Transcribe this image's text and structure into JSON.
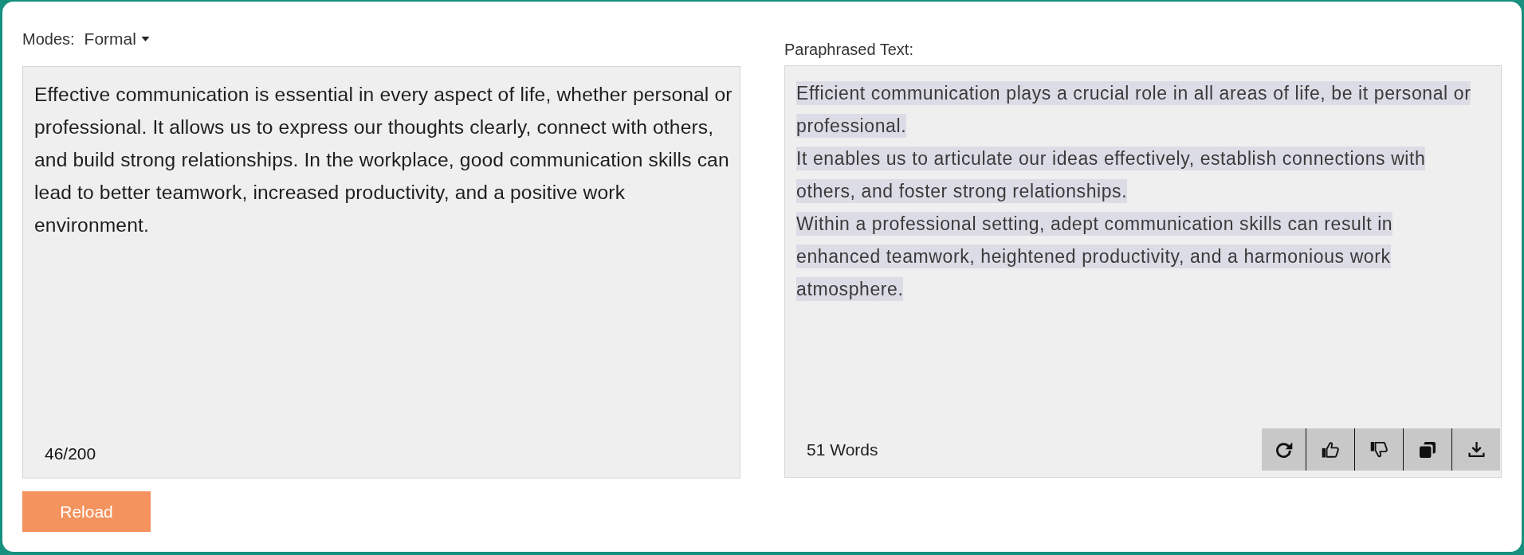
{
  "modes": {
    "label": "Modes:",
    "value": "Formal"
  },
  "input": {
    "text": "Effective communication is essential in every aspect of life, whether personal or professional. It allows us to express our thoughts clearly, connect with others, and build strong relationships. In the workplace, good communication skills can lead to better teamwork, increased productivity, and a positive work environment.",
    "counter": "46/200"
  },
  "reload_button": {
    "label": "Reload"
  },
  "output": {
    "label": "Paraphrased Text:",
    "sentences": [
      {
        "text": "Efficient communication plays a crucial role in all areas of life, be it personal or professional.",
        "highlighted": true
      },
      {
        "text": "It enables us to articulate our ideas effectively, establish connections with others, and foster strong relationships.",
        "highlighted": true
      },
      {
        "text": "Within a professional setting, adept communication skills can result in enhanced teamwork, heightened productivity, and a harmonious work atmosphere.",
        "highlighted": true
      }
    ],
    "word_count": "51 Words"
  }
}
